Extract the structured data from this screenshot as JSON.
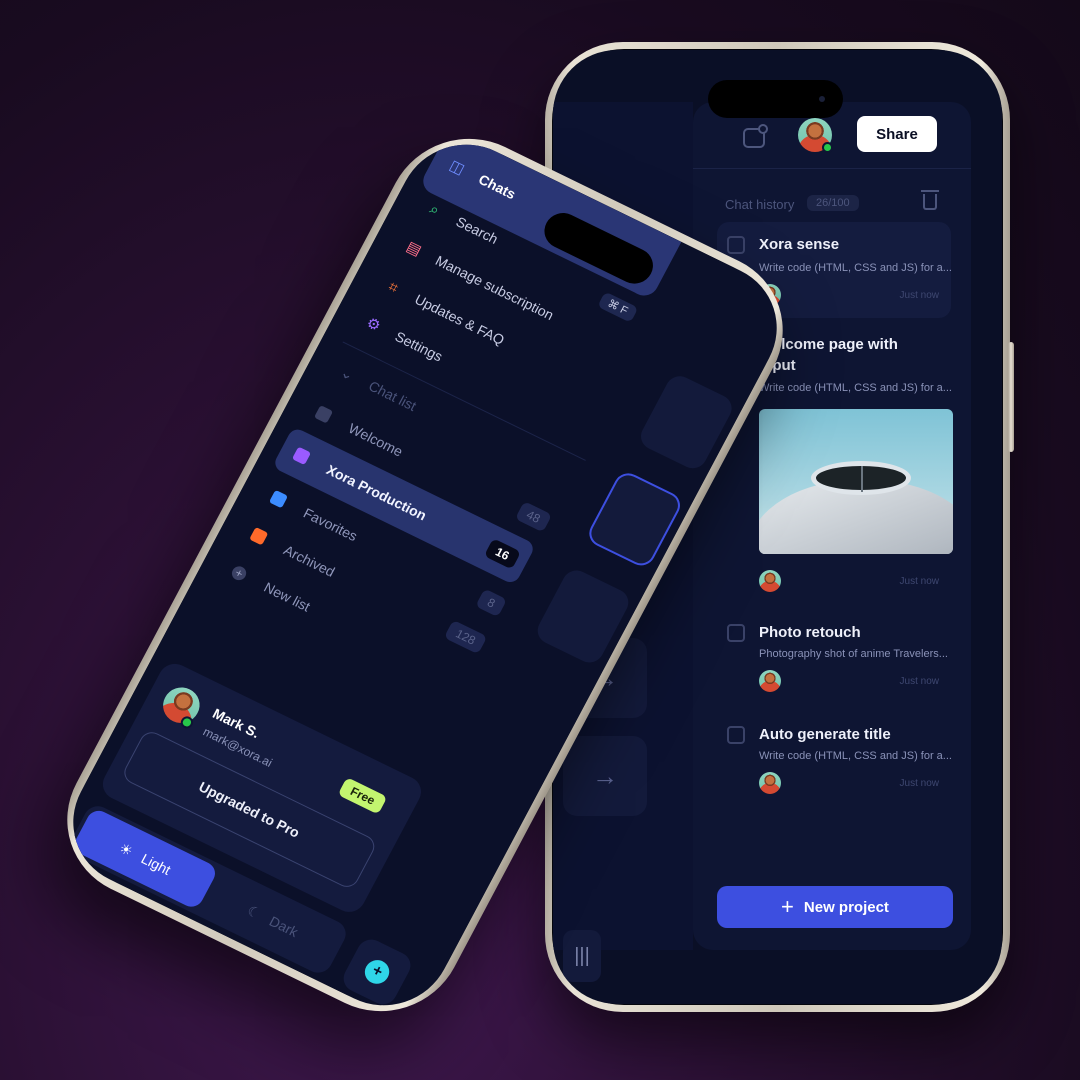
{
  "sidebar": {
    "menu": [
      {
        "label": "Chats",
        "icon": "chat-icon"
      },
      {
        "label": "Search",
        "icon": "search-icon",
        "shortcut": "⌘ F"
      },
      {
        "label": "Manage subscription",
        "icon": "card-icon"
      },
      {
        "label": "Updates & FAQ",
        "icon": "scan-icon"
      },
      {
        "label": "Settings",
        "icon": "gear-icon"
      }
    ],
    "chat_list_label": "Chat list",
    "lists": [
      {
        "label": "Welcome",
        "count": "48",
        "color": "#3a4064"
      },
      {
        "label": "Xora Production",
        "count": "16",
        "color": "#9a5bff"
      },
      {
        "label": "Favorites",
        "count": "8",
        "color": "#3c8cff"
      },
      {
        "label": "Archived",
        "count": "128",
        "color": "#ff6a2a"
      }
    ],
    "new_list_label": "New list",
    "user": {
      "name": "Mark S.",
      "email": "mark@xora.ai",
      "plan": "Free"
    },
    "upgrade_label": "Upgraded to Pro",
    "modes": {
      "light": "Light",
      "dark": "Dark"
    }
  },
  "header": {
    "share_label": "Share"
  },
  "history": {
    "label": "Chat history",
    "count": "26/100",
    "items": [
      {
        "title": "Xora sense",
        "desc": "Write code (HTML, CSS and JS) for a...",
        "time": "Just now"
      },
      {
        "title": "Welcome page with input",
        "desc": "Write code (HTML, CSS and JS) for a...",
        "time": "Just now"
      },
      {
        "title": "Photo retouch",
        "desc": "Photography shot of anime Travelers...",
        "time": "Just now"
      },
      {
        "title": "Auto generate title",
        "desc": "Write code (HTML, CSS and JS) for a...",
        "time": "Just now"
      }
    ]
  },
  "new_project_label": "New project",
  "colors": {
    "accent": "#3d4fe0",
    "free_badge": "#c3f56f",
    "background": "#2a1033"
  }
}
